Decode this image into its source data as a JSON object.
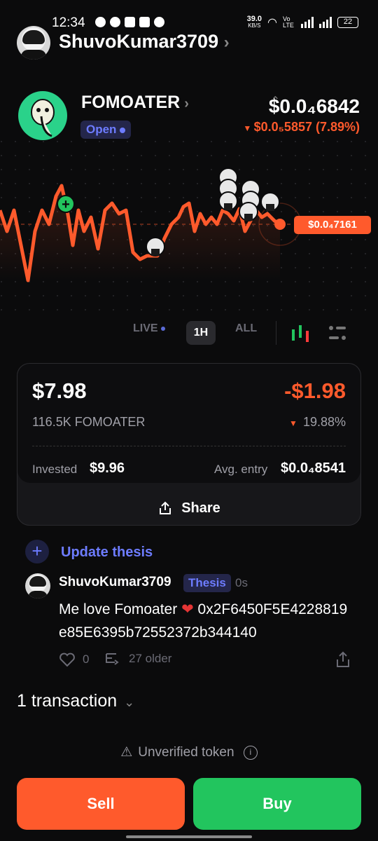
{
  "status_bar": {
    "time": "12:34",
    "net_speed": "39.0",
    "net_unit": "KB/S",
    "network": "Vo LTE",
    "battery": "22"
  },
  "header": {
    "username": "ShuvoKumar3709"
  },
  "token": {
    "name": "FOMOATER",
    "status": "Open",
    "price": "$0.0₄6842",
    "change": "$0.0₅5857 (7.89%)",
    "current_price_tag": "$0.0₄7161"
  },
  "timeframes": {
    "live": "LIVE",
    "hour": "1H",
    "all": "ALL"
  },
  "position": {
    "value": "$7.98",
    "pnl": "-$1.98",
    "quantity": "116.5K FOMOATER",
    "pnl_percent": "19.88%",
    "invested_label": "Invested",
    "invested": "$9.96",
    "avg_entry_label": "Avg. entry",
    "avg_entry": "$0.0₄8541",
    "share_label": "Share"
  },
  "thesis": {
    "update_label": "Update thesis",
    "username": "ShuvoKumar3709",
    "badge": "Thesis",
    "age": "0s",
    "text_prefix": "Me love Fomoater",
    "text_suffix": "0x2F6450F5E4228819e85E6395b72552372b344140",
    "likes": "0",
    "older": "27 older"
  },
  "transactions": {
    "label": "1 transaction"
  },
  "footer": {
    "warning": "Unverified token",
    "sell": "Sell",
    "buy": "Buy"
  },
  "colors": {
    "accent": "#ff5a2c",
    "buy": "#22c55e",
    "badge": "#6d7cff"
  }
}
